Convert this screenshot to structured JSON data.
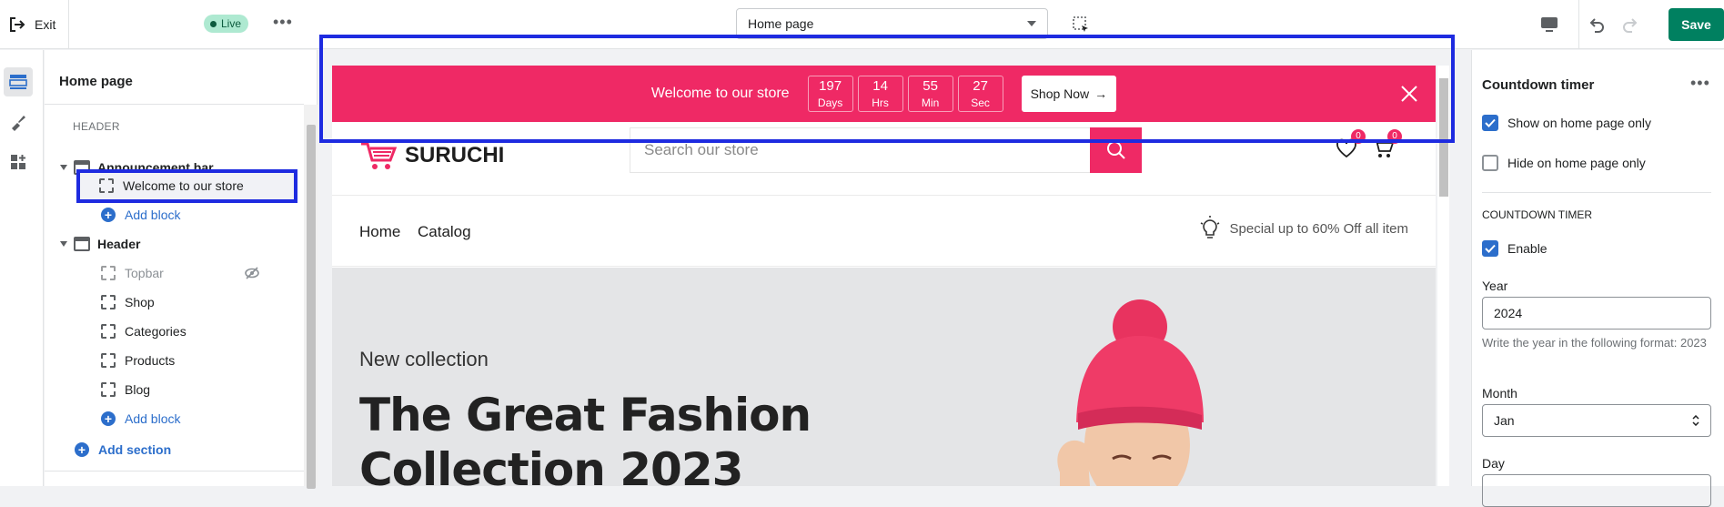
{
  "topbar": {
    "exit_label": "Exit",
    "status_label": "Live",
    "page_select_value": "Home page",
    "save_label": "Save"
  },
  "left": {
    "title": "Home page",
    "header_group_label": "HEADER",
    "items": [
      {
        "label": "Announcement bar"
      },
      {
        "label": "Welcome to our store"
      },
      {
        "label": "Add block"
      },
      {
        "label": "Header"
      },
      {
        "label": "Topbar"
      },
      {
        "label": "Shop"
      },
      {
        "label": "Categories"
      },
      {
        "label": "Products"
      },
      {
        "label": "Blog"
      },
      {
        "label": "Add block"
      }
    ],
    "add_section_label": "Add section"
  },
  "preview": {
    "announcement": {
      "text": "Welcome to our store",
      "countdown": [
        {
          "value": "197",
          "unit": "Days"
        },
        {
          "value": "14",
          "unit": "Hrs"
        },
        {
          "value": "55",
          "unit": "Min"
        },
        {
          "value": "27",
          "unit": "Sec"
        }
      ],
      "button_label": "Shop Now"
    },
    "logo_text": "SURUCHI",
    "search_placeholder": "Search our store",
    "wishlist_count": "0",
    "cart_count": "0",
    "nav": [
      "Home",
      "Catalog"
    ],
    "promo_text": "Special up to 60% Off all item",
    "hero": {
      "subtitle": "New collection",
      "title_line1": "The Great Fashion",
      "title_line2": "Collection 2023"
    },
    "colors": {
      "brand": "#ef2965"
    }
  },
  "right": {
    "title": "Countdown timer",
    "show_home_only_label": "Show on home page only",
    "show_home_only": true,
    "hide_home_only_label": "Hide on home page only",
    "hide_home_only": false,
    "section_heading": "COUNTDOWN TIMER",
    "enable_label": "Enable",
    "enable": true,
    "year_label": "Year",
    "year_value": "2024",
    "year_help": "Write the year in the following format: 2023",
    "month_label": "Month",
    "month_value": "Jan",
    "day_label": "Day"
  },
  "icons": [
    "exit-icon",
    "more-icon",
    "inspector-icon",
    "desktop-icon",
    "undo-icon",
    "redo-icon",
    "sections-icon",
    "theme-settings-icon",
    "app-blocks-icon",
    "hidden-eye-icon",
    "close-icon",
    "search-icon",
    "heart-icon",
    "cart-icon",
    "bulb-icon"
  ]
}
